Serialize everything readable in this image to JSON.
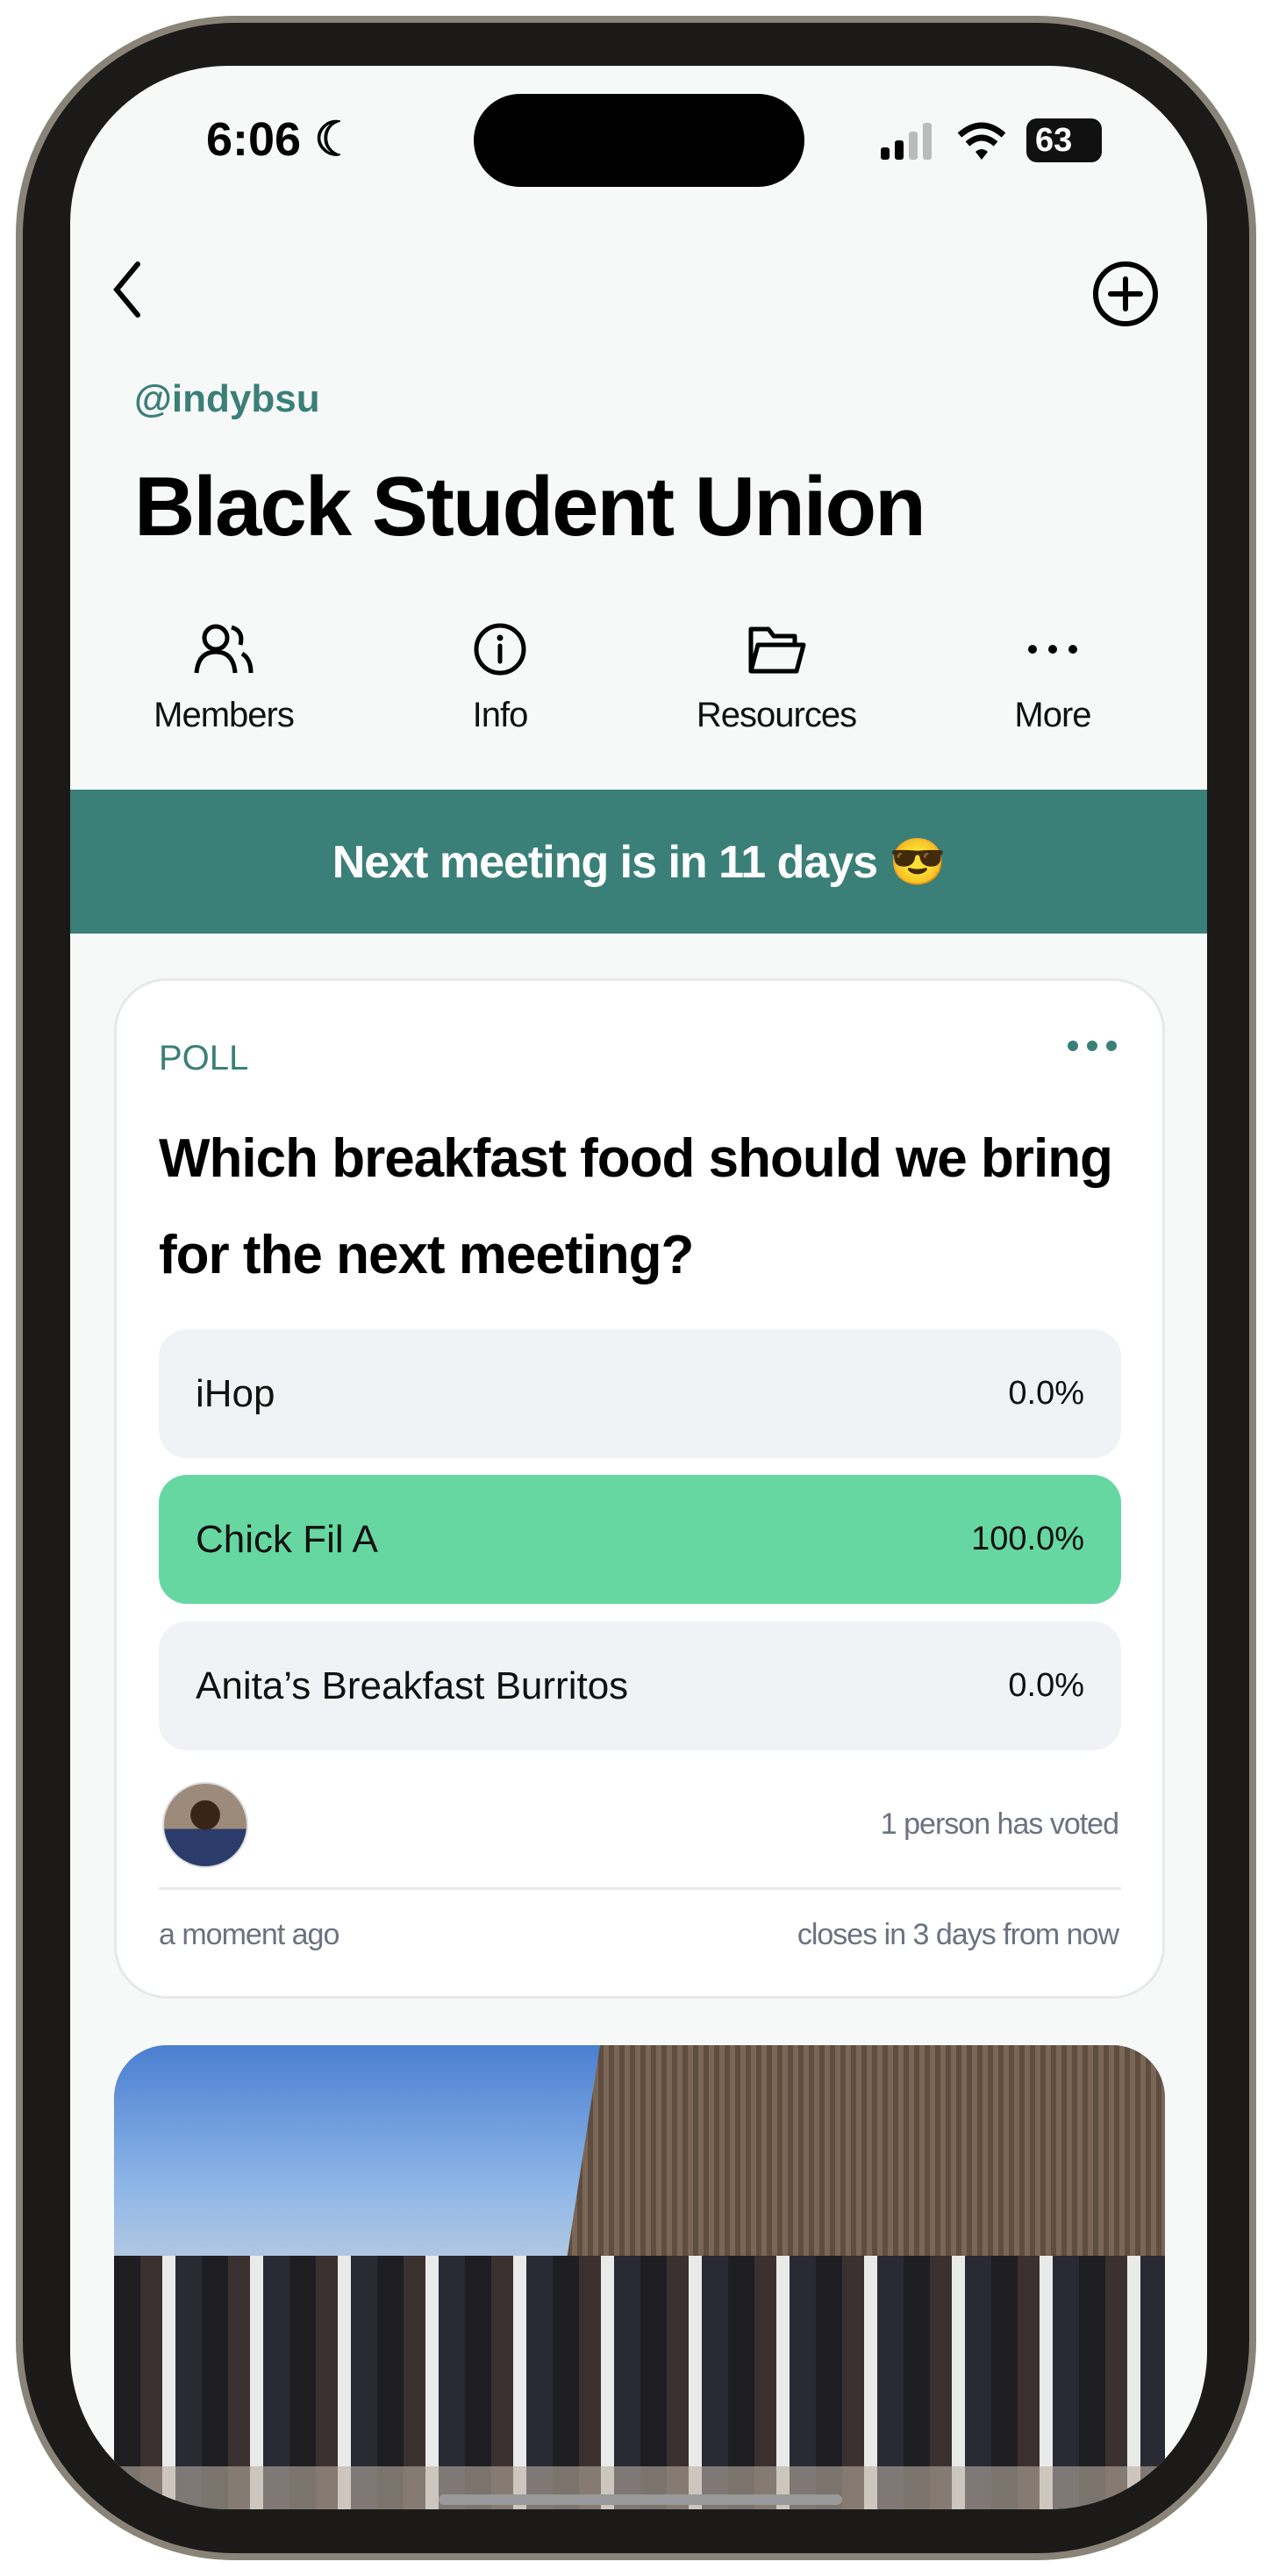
{
  "status_bar": {
    "time": "6:06",
    "battery": "63",
    "icons": [
      "moon-icon",
      "signal-icon",
      "wifi-icon",
      "battery-icon"
    ]
  },
  "nav": {
    "back_icon": "chevron-left-icon",
    "add_icon": "plus-circle-icon"
  },
  "group": {
    "handle": "@indybsu",
    "title": "Black Student Union"
  },
  "tabs": [
    {
      "label": "Members",
      "icon": "users-icon"
    },
    {
      "label": "Info",
      "icon": "info-icon"
    },
    {
      "label": "Resources",
      "icon": "folder-open-icon"
    },
    {
      "label": "More",
      "icon": "more-horizontal-icon"
    }
  ],
  "banner": {
    "text": "Next meeting is in 11 days 😎"
  },
  "poll": {
    "label": "POLL",
    "question": "Which breakfast food should we bring for the next meeting?",
    "options": [
      {
        "label": "iHop",
        "percent": "0.0%"
      },
      {
        "label": "Chick Fil A",
        "percent": "100.0%"
      },
      {
        "label": "Anita’s Breakfast Burritos",
        "percent": "0.0%"
      }
    ],
    "votes": "1 person has voted",
    "posted": "a moment ago",
    "closes": "closes in 3 days from now"
  },
  "colors": {
    "accent": "#3a7f78",
    "winner": "#67d7a2",
    "option_bg": "#f1f2f5"
  }
}
